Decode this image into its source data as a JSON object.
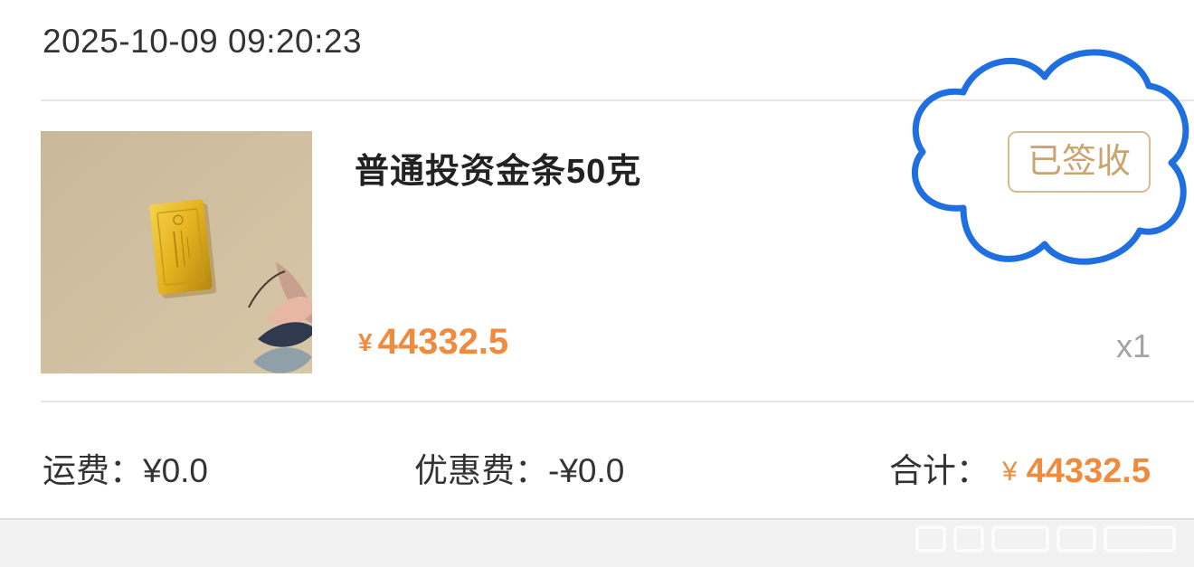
{
  "order": {
    "timestamp": "2025-10-09 09:20:23",
    "status": "已签收",
    "product": {
      "title": "普通投资金条50克",
      "currency_symbol": "¥",
      "price": "44332.5",
      "quantity": "x1",
      "image": "gold-bar-photo"
    },
    "summary": {
      "shipping_label": "运费：",
      "shipping_value": "¥0.0",
      "discount_label": "优惠费：",
      "discount_value": "-¥0.0",
      "total_label": "合计：",
      "total_symbol": "¥",
      "total_value": "44332.5"
    }
  },
  "colors": {
    "price": "#f08a3c",
    "badge_border": "#d9bb8d",
    "badge_text": "#caa46e",
    "annotation": "#1f6fe0"
  }
}
